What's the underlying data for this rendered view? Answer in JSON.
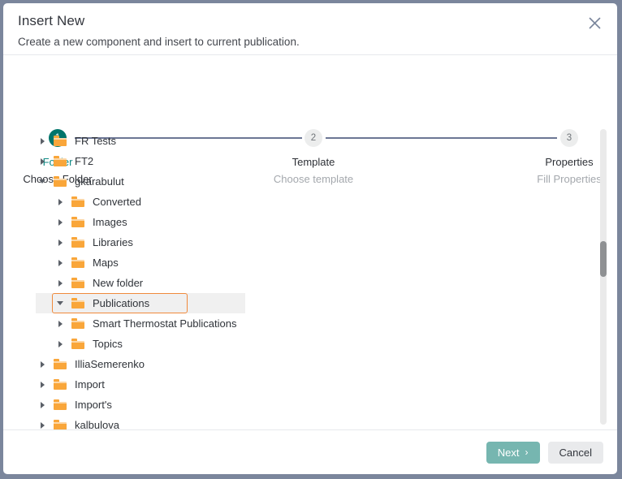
{
  "dialog": {
    "title": "Insert New",
    "subtitle": "Create a new component and insert to current publication.",
    "close_icon": "close-icon"
  },
  "stepper": {
    "steps": [
      {
        "number": "1",
        "label": "Folder",
        "sublabel": "Choose Folder",
        "state": "active"
      },
      {
        "number": "2",
        "label": "Template",
        "sublabel": "Choose template",
        "state": "inactive"
      },
      {
        "number": "3",
        "label": "Properties",
        "sublabel": "Fill Properties",
        "state": "inactive"
      }
    ]
  },
  "tree": {
    "rows": [
      {
        "label": "FR Tests",
        "depth": 0,
        "expanded": false,
        "selected": false
      },
      {
        "label": "FT2",
        "depth": 0,
        "expanded": false,
        "selected": false
      },
      {
        "label": "gkarabulut",
        "depth": 0,
        "expanded": true,
        "selected": false
      },
      {
        "label": "Converted",
        "depth": 1,
        "expanded": false,
        "selected": false
      },
      {
        "label": "Images",
        "depth": 1,
        "expanded": false,
        "selected": false
      },
      {
        "label": "Libraries",
        "depth": 1,
        "expanded": false,
        "selected": false
      },
      {
        "label": "Maps",
        "depth": 1,
        "expanded": false,
        "selected": false
      },
      {
        "label": "New folder",
        "depth": 1,
        "expanded": false,
        "selected": false
      },
      {
        "label": "Publications",
        "depth": 1,
        "expanded": true,
        "selected": true
      },
      {
        "label": "Smart Thermostat Publications",
        "depth": 1,
        "expanded": false,
        "selected": false
      },
      {
        "label": "Topics",
        "depth": 1,
        "expanded": false,
        "selected": false
      },
      {
        "label": "IlliaSemerenko",
        "depth": 0,
        "expanded": false,
        "selected": false
      },
      {
        "label": "Import",
        "depth": 0,
        "expanded": false,
        "selected": false
      },
      {
        "label": "Import's",
        "depth": 0,
        "expanded": false,
        "selected": false
      },
      {
        "label": "kalbulova",
        "depth": 0,
        "expanded": false,
        "selected": false
      }
    ]
  },
  "footer": {
    "next_label": "Next",
    "next_chevron": "›",
    "cancel_label": "Cancel"
  },
  "colors": {
    "accent_active": "#00756b",
    "accent_label": "#0f8a85",
    "folder": "#f9a63a",
    "selection_border": "#f08a3c",
    "next_button": "#76b6b0",
    "cancel_button": "#e9eaec",
    "step_line": "#6c7694",
    "dialog_border": "#7b869c"
  }
}
